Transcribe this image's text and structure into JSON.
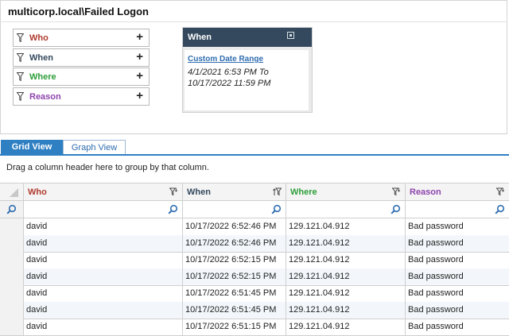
{
  "window": {
    "title": "multicorp.local\\Failed Logon"
  },
  "filters": [
    {
      "label": "Who",
      "color": "#b03a2e"
    },
    {
      "label": "When",
      "color": "#34495e"
    },
    {
      "label": "Where",
      "color": "#2e9e3a"
    },
    {
      "label": "Reason",
      "color": "#8e44ad"
    }
  ],
  "when_panel": {
    "title": "When",
    "link": "Custom Date Range",
    "range_from": "4/1/2021 6:53 PM To",
    "range_to": "10/17/2022 11:59 PM"
  },
  "tabs": [
    {
      "label": "Grid View",
      "active": true
    },
    {
      "label": "Graph View",
      "active": false
    }
  ],
  "group_hint": "Drag a column header here to group by that column.",
  "columns": [
    {
      "label": "Who",
      "color": "#b03a2e",
      "icon": "filter-icon"
    },
    {
      "label": "When",
      "color": "#34495e",
      "icon": "sort-filter-icon"
    },
    {
      "label": "Where",
      "color": "#2e9e3a",
      "icon": "filter-icon"
    },
    {
      "label": "Reason",
      "color": "#8e44ad",
      "icon": "filter-icon"
    }
  ],
  "rows": [
    {
      "who": "david",
      "when": "10/17/2022 6:52:46 PM",
      "where": "129.121.04.912",
      "reason": "Bad password"
    },
    {
      "who": "david",
      "when": "10/17/2022 6:52:46 PM",
      "where": "129.121.04.912",
      "reason": "Bad password"
    },
    {
      "who": "david",
      "when": "10/17/2022 6:52:15 PM",
      "where": "129.121.04.912",
      "reason": "Bad password"
    },
    {
      "who": "david",
      "when": "10/17/2022 6:52:15 PM",
      "where": "129.121.04.912",
      "reason": "Bad password"
    },
    {
      "who": "david",
      "when": "10/17/2022 6:51:45 PM",
      "where": "129.121.04.912",
      "reason": "Bad password"
    },
    {
      "who": "david",
      "when": "10/17/2022 6:51:45 PM",
      "where": "129.121.04.912",
      "reason": "Bad password"
    },
    {
      "who": "david",
      "when": "10/17/2022 6:51:15 PM",
      "where": "129.121.04.912",
      "reason": "Bad password"
    }
  ]
}
